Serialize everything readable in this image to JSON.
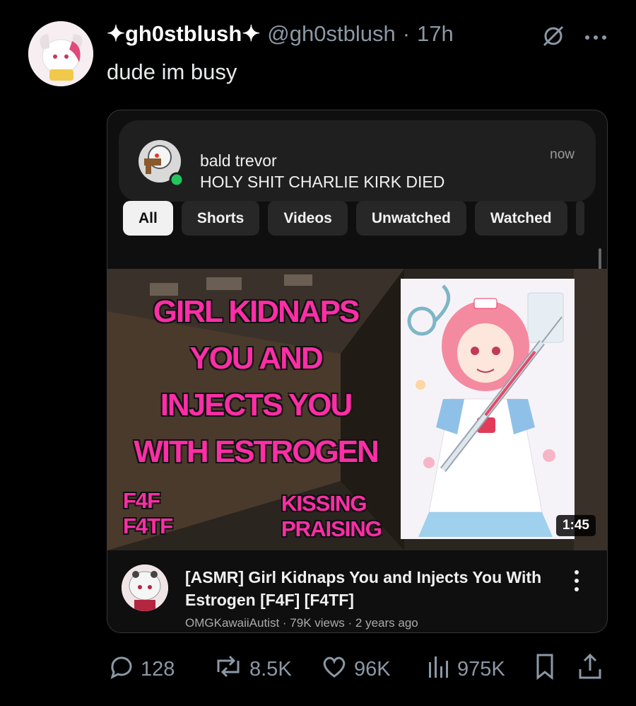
{
  "post": {
    "display_name": "✦gh0stblush✦",
    "handle": "@gh0stblush",
    "separator": "·",
    "time": "17h",
    "text": "dude im busy"
  },
  "notification": {
    "sender": "bald trevor",
    "message": "HOLY SHIT CHARLIE KIRK DIED",
    "time": "now"
  },
  "chips": [
    "All",
    "Shorts",
    "Videos",
    "Unwatched",
    "Watched"
  ],
  "thumbnail": {
    "title_lines": [
      "GIRL KIDNAPS",
      "YOU AND",
      "INJECTS YOU",
      "WITH ESTROGEN"
    ],
    "tag_left": [
      "F4F",
      "F4TF"
    ],
    "tag_right": [
      "KISSING",
      "PRAISING"
    ],
    "duration": "1:45"
  },
  "video": {
    "title": "[ASMR] Girl Kidnaps You and Injects You With Estrogen [F4F] [F4TF]",
    "meta": "OMGKawaiiAutist · 79K views · 2 years ago"
  },
  "actions": {
    "replies": "128",
    "reposts": "8.5K",
    "likes": "96K",
    "views": "975K"
  },
  "colors": {
    "accent_pink": "#ff2ea6",
    "muted": "#8b98a5",
    "online": "#22c55e"
  },
  "icons": {
    "header": [
      "grok-icon",
      "more-icon"
    ],
    "actions": [
      "reply-icon",
      "repost-icon",
      "like-icon",
      "views-icon",
      "bookmark-icon",
      "share-icon"
    ]
  }
}
